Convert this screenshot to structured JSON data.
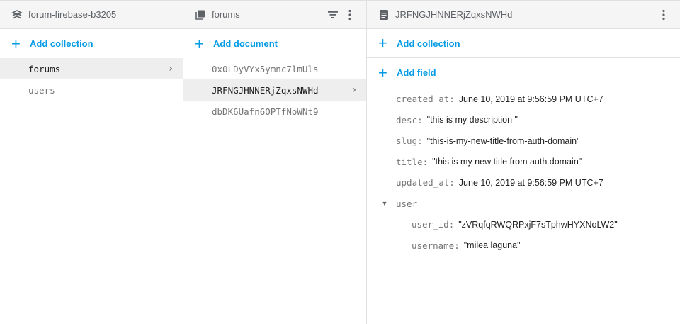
{
  "panel1": {
    "title": "forum-firebase-b3205",
    "icon": "firestore-icon",
    "add_label": "Add collection",
    "items": [
      {
        "label": "forums",
        "selected": true
      },
      {
        "label": "users",
        "selected": false
      }
    ]
  },
  "panel2": {
    "title": "forums",
    "icon": "collection-icon",
    "add_label": "Add document",
    "items": [
      {
        "label": "0x0LDyVYx5ymnc7lmUls"
      },
      {
        "label": "JRFNGJHNNERjZqxsNWHd"
      },
      {
        "label": "dbDK6Uafn6OPTfNoWNt9"
      }
    ]
  },
  "panel3": {
    "title": "JRFNGJHNNERjZqxsNWHd",
    "icon": "document-icon",
    "add_collection_label": "Add collection",
    "add_field_label": "Add field",
    "fields": [
      {
        "key": "created_at",
        "value": "June 10, 2019 at 9:56:59 PM UTC+7"
      },
      {
        "key": "desc",
        "value": "\"this is my description \""
      },
      {
        "key": "slug",
        "value": "\"this-is-my-new-title-from-auth-domain\""
      },
      {
        "key": "title",
        "value": "\"this is my new title from auth domain\""
      },
      {
        "key": "updated_at",
        "value": "June 10, 2019 at 9:56:59 PM UTC+7"
      }
    ],
    "map_field": {
      "key": "user",
      "children": [
        {
          "key": "user_id",
          "value": "\"zVRqfqRWQRPxjF7sTphwHYXNoLW2\""
        },
        {
          "key": "username",
          "value": "\"milea laguna\""
        }
      ]
    }
  },
  "colors": {
    "accent": "#039be5",
    "header_bg": "#f5f5f5",
    "selected_bg": "#eeeeee"
  }
}
